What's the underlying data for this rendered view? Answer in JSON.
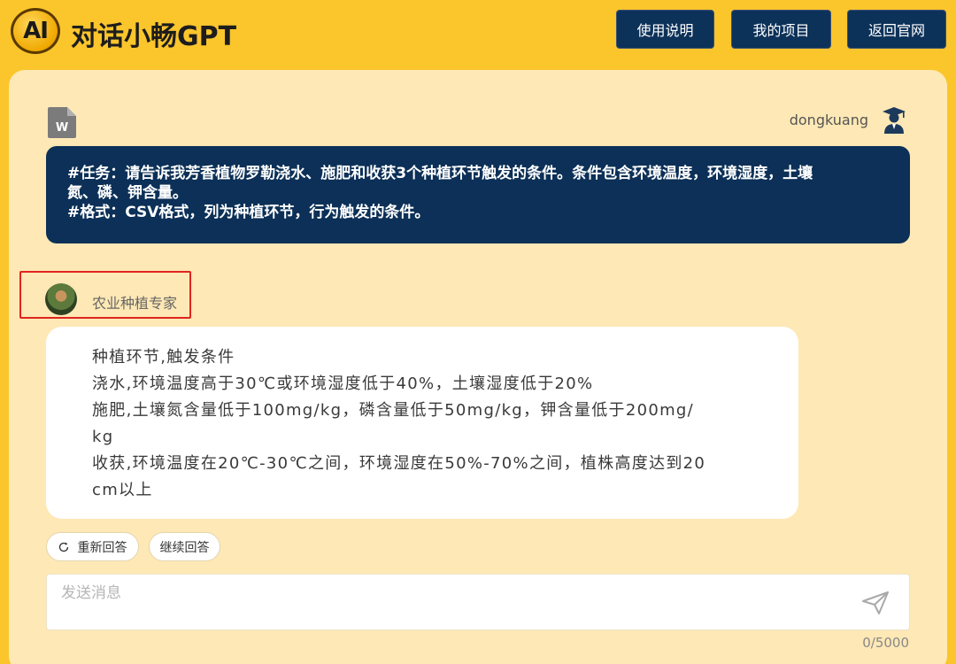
{
  "header": {
    "logo_text": "AI",
    "title": "对话小畅GPT",
    "nav": [
      "使用说明",
      "我的项目",
      "返回官网"
    ]
  },
  "user_message": {
    "username": "dongkuang",
    "file_icon_label": "W",
    "lines": [
      "#任务：请告诉我芳香植物罗勒浇水、施肥和收获3个种植环节触发的条件。条件包含环境温度，环境湿度，土壤",
      "氮、磷、钾含量。",
      "#格式：CSV格式，列为种植环节，行为触发的条件。"
    ]
  },
  "assistant": {
    "name": "农业种植专家",
    "reply_lines": [
      "种植环节,触发条件",
      "浇水,环境温度高于30℃或环境湿度低于40%，土壤湿度低于20%",
      "施肥,土壤氮含量低于100mg/kg，磷含量低于50mg/kg，钾含量低于200mg/",
      "kg",
      "收获,环境温度在20℃-30℃之间，环境湿度在50%-70%之间，植株高度达到20",
      "cm以上"
    ]
  },
  "actions": {
    "regenerate_label": "重新回答",
    "continue_label": "继续回答"
  },
  "composer": {
    "placeholder": "发送消息",
    "value": "",
    "counter": "0/5000"
  },
  "colors": {
    "background": "#fbc52c",
    "panel": "#fee8b5",
    "navy": "#0c3057",
    "highlight_border": "#e0241e"
  },
  "icons": [
    "word-file-icon",
    "user-graduate-icon",
    "refresh-icon",
    "send-icon"
  ]
}
